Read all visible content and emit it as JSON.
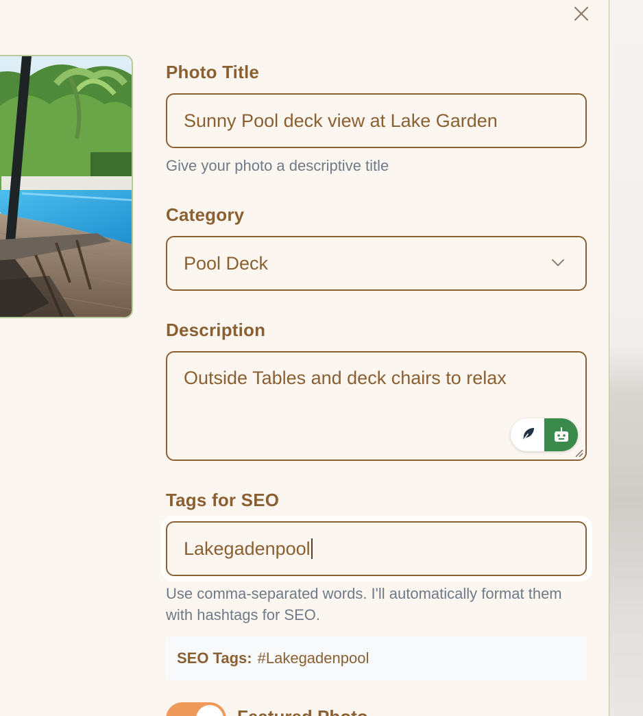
{
  "close_icon": "close-icon",
  "form": {
    "title": {
      "label": "Photo Title",
      "value": "Sunny Pool deck view at Lake Garden",
      "help": "Give your photo a descriptive title"
    },
    "category": {
      "label": "Category",
      "value": "Pool Deck",
      "icon": "chevron-down-icon"
    },
    "description": {
      "label": "Description",
      "value": "Outside Tables and deck chairs to relax",
      "tools": [
        "feather-icon",
        "robot-icon"
      ]
    },
    "tags": {
      "label": "Tags for SEO",
      "value": "Lakegadenpool",
      "help": "Use comma-separated words. I'll automatically format them with hashtags for SEO."
    },
    "seo_preview": {
      "key": "SEO Tags:",
      "value": "#Lakegadenpool"
    },
    "featured": {
      "label": "Featured Photo",
      "on": true
    }
  },
  "colors": {
    "accent": "#8a6032",
    "panel_bg": "#fcf6f0",
    "photo_border": "#b6c99a",
    "ai_green": "#3a8a4c",
    "toggle_on": "#ef9a5a"
  }
}
